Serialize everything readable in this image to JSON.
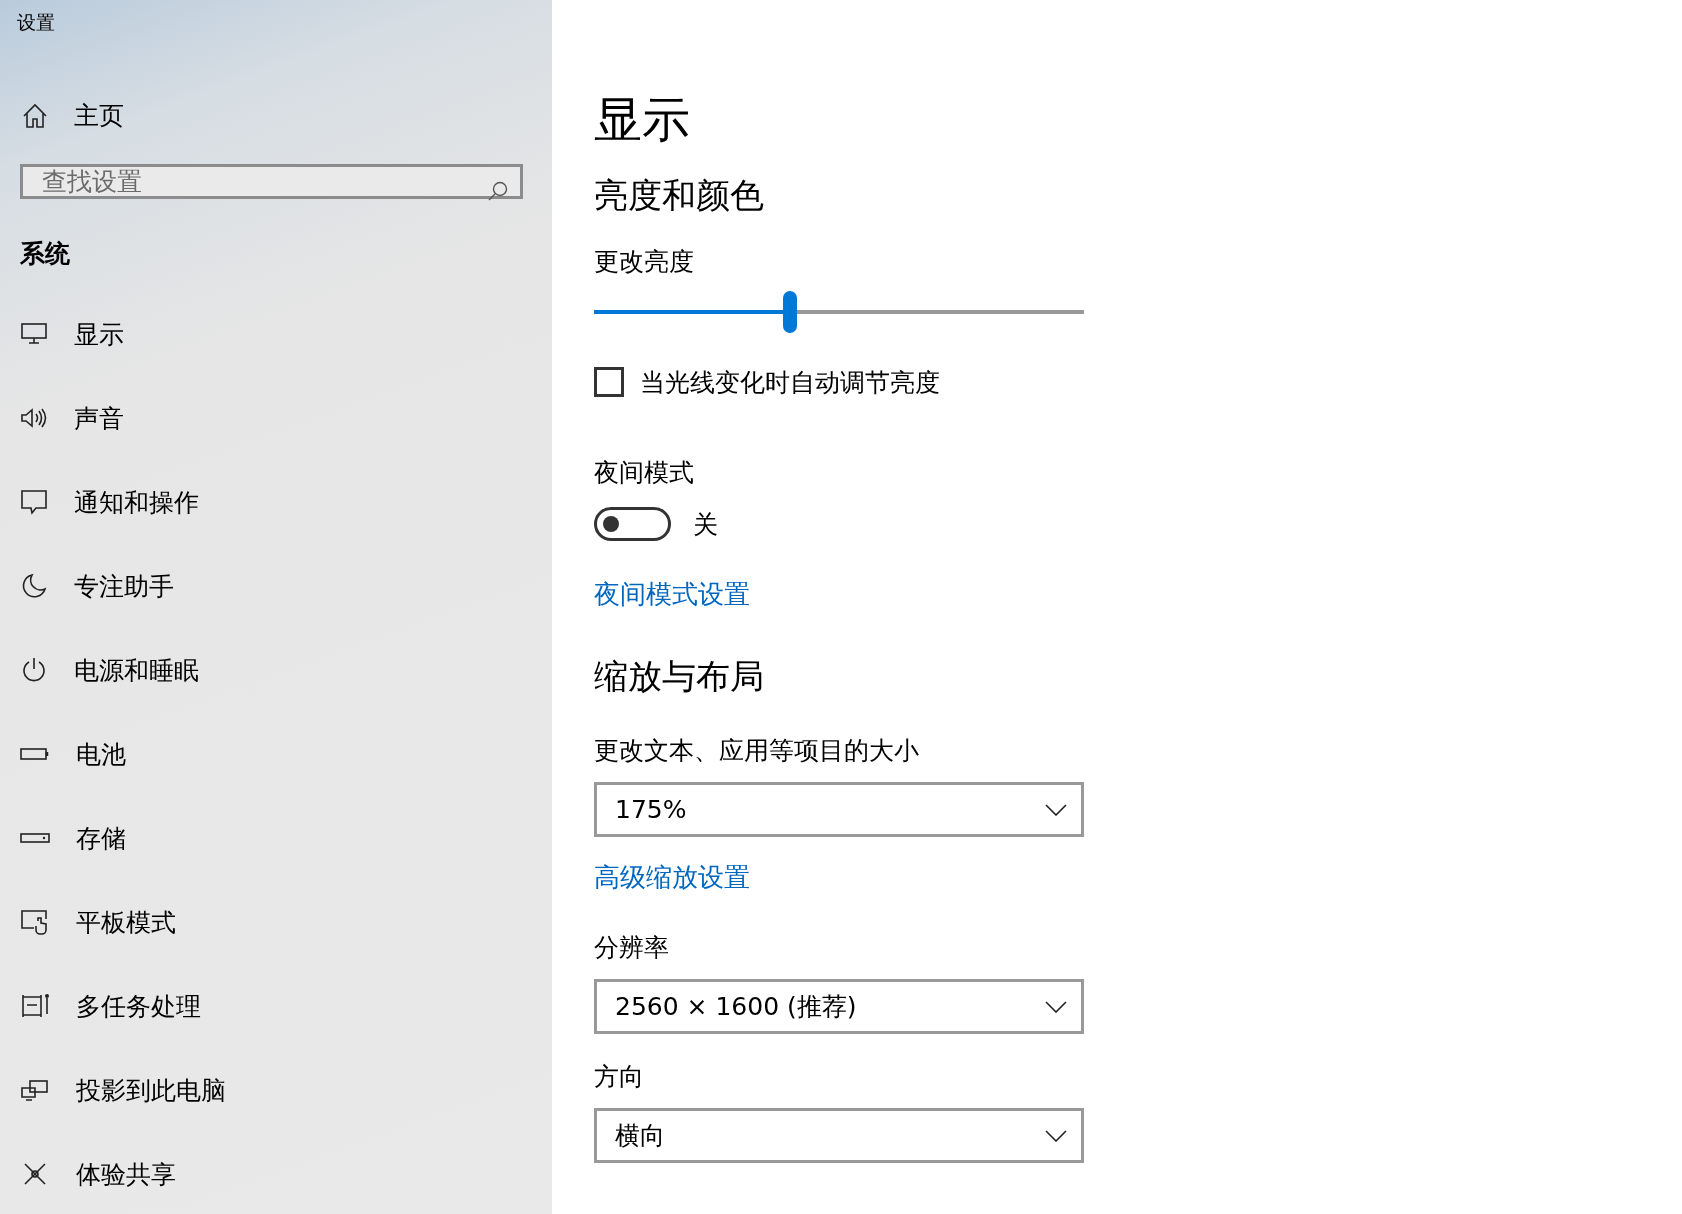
{
  "window": {
    "title": "设置"
  },
  "sidebar": {
    "home": "主页",
    "search": {
      "placeholder": "查找设置"
    },
    "section": "系统",
    "items": [
      {
        "label": "显示"
      },
      {
        "label": "声音"
      },
      {
        "label": "通知和操作"
      },
      {
        "label": "专注助手"
      },
      {
        "label": "电源和睡眠"
      },
      {
        "label": "电池"
      },
      {
        "label": "存储"
      },
      {
        "label": "平板模式"
      },
      {
        "label": "多任务处理"
      },
      {
        "label": "投影到此电脑"
      },
      {
        "label": "体验共享"
      }
    ]
  },
  "page": {
    "title": "显示",
    "brightness": {
      "heading": "亮度和颜色",
      "label": "更改亮度",
      "level": 0.4,
      "auto": {
        "label": "当光线变化时自动调节亮度",
        "checked": false
      },
      "night": {
        "label": "夜间模式",
        "on": false,
        "state": "关"
      },
      "link": "夜间模式设置"
    },
    "scale": {
      "heading": "缩放与布局",
      "size": {
        "label": "更改文本、应用等项目的大小",
        "value": "175%"
      },
      "link": "高级缩放设置",
      "resolution": {
        "label": "分辨率",
        "value": "2560 × 1600 (推荐)"
      },
      "orientation": {
        "label": "方向",
        "value": "横向"
      }
    }
  }
}
